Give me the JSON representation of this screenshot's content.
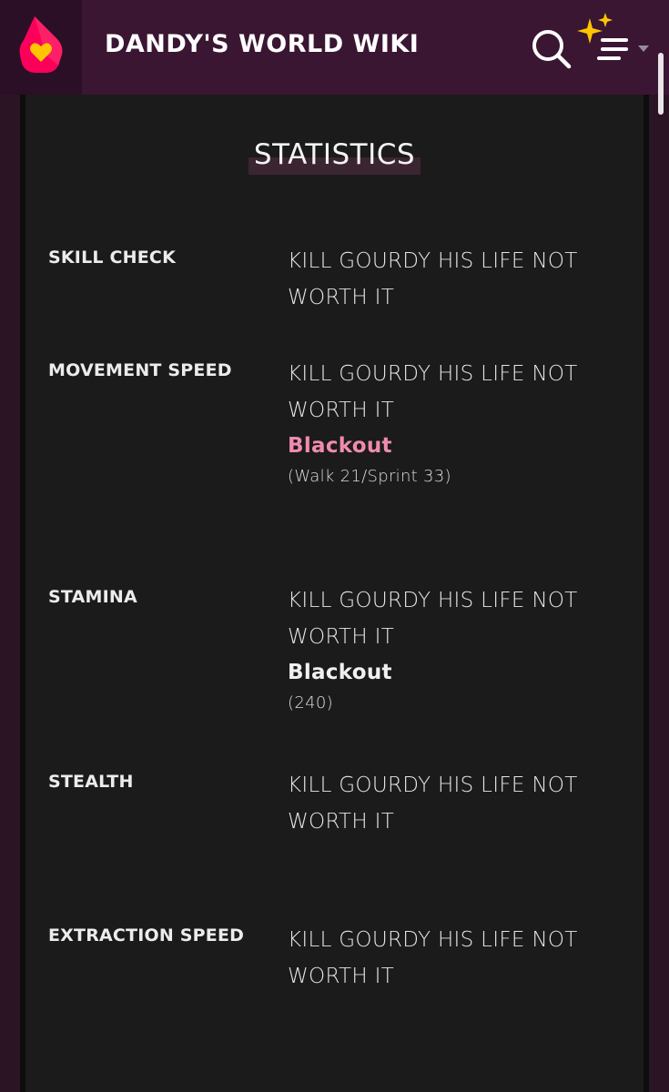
{
  "header": {
    "site_title": "DANDY'S WORLD WIKI",
    "brand_color": "#3a1633",
    "logo_icon": "fandom-heart-logo-icon",
    "search_icon": "search-icon",
    "menu_icon": "sparkle-menu-icon"
  },
  "section": {
    "title": "STATISTICS"
  },
  "stats": [
    {
      "label": "SKILL CHECK",
      "value": "KILL GOURDY HIS LIFE NOT WORTH IT"
    },
    {
      "label": "MOVEMENT SPEED",
      "value": "KILL GOURDY HIS LIFE NOT WORTH IT",
      "variant_label": "Blackout",
      "variant_note": "(Walk 21/Sprint 33)"
    },
    {
      "label": "STAMINA",
      "value": "KILL GOURDY HIS LIFE NOT WORTH IT",
      "variant_label": "Blackout",
      "variant_note": "(240)"
    },
    {
      "label": "STEALTH",
      "value": "KILL GOURDY HIS LIFE NOT WORTH IT"
    },
    {
      "label": "EXTRACTION SPEED",
      "value": "KILL GOURDY HIS LIFE NOT WORTH IT"
    }
  ],
  "colors": {
    "accent_pink": "#f08bb0",
    "content_bg": "#1b1b1b",
    "page_bg": "#2b1424"
  }
}
